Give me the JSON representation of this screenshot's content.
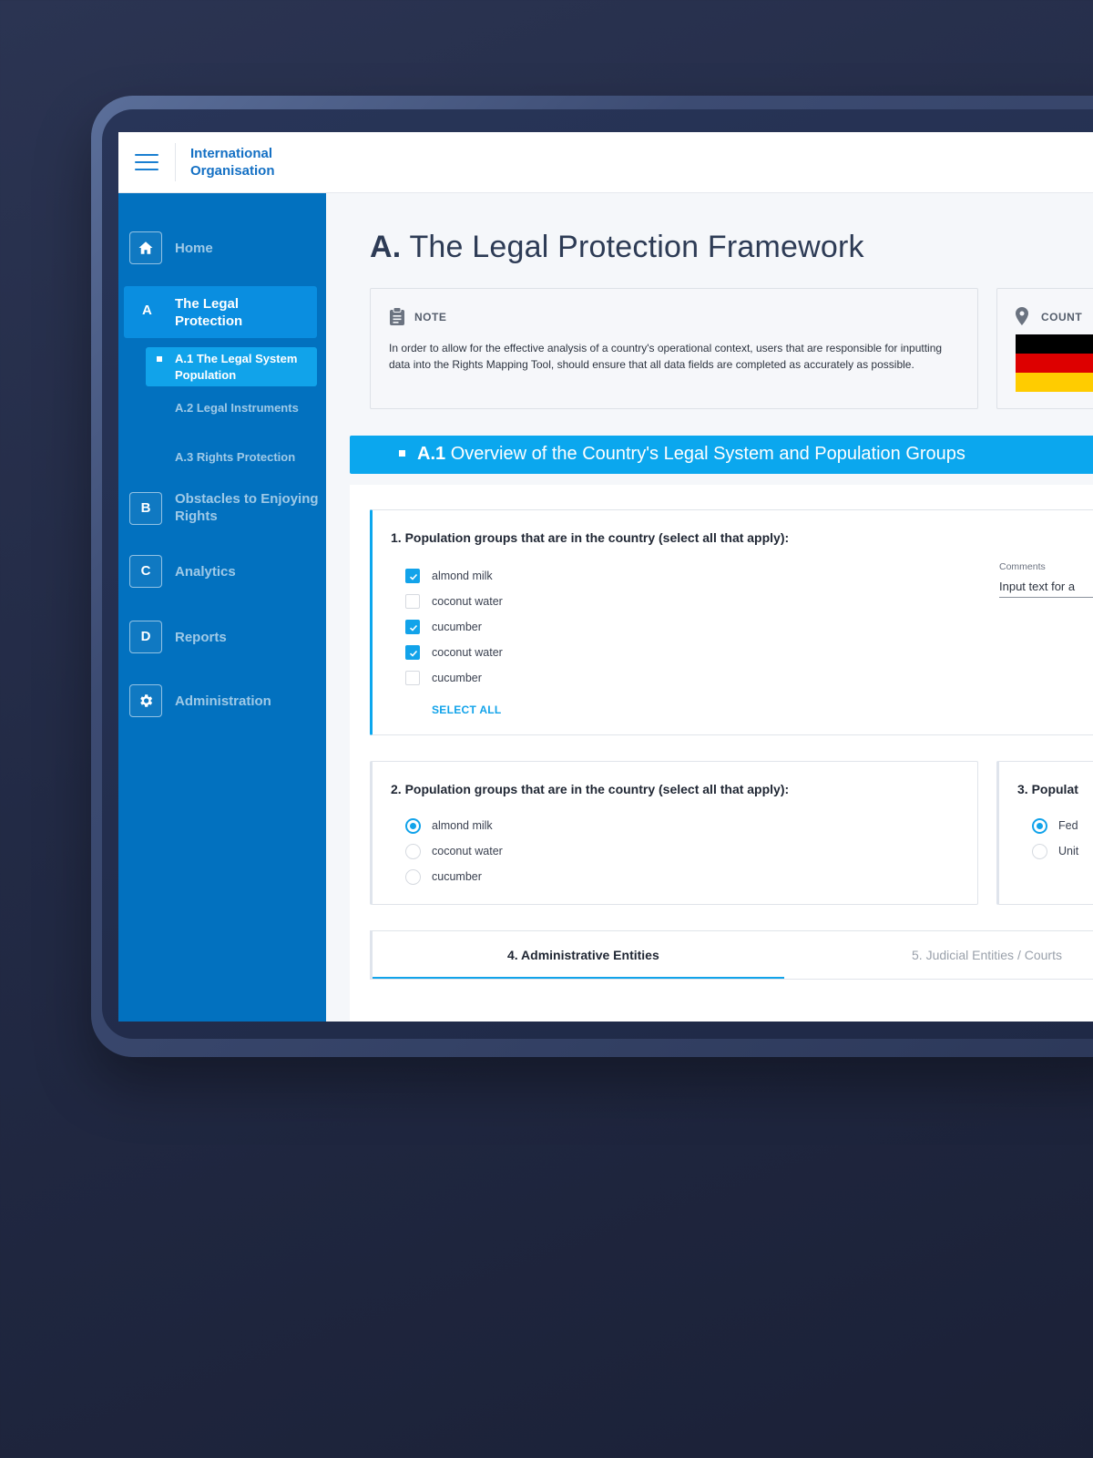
{
  "app": {
    "brand": "International Organisation"
  },
  "sidebar": {
    "home": {
      "label": "Home",
      "icon": "home-icon"
    },
    "active_section": {
      "letter": "A",
      "label": "The Legal Protection"
    },
    "sub_items": [
      {
        "label": "A.1 The Legal System Population",
        "active": true
      },
      {
        "label": "A.2 Legal Instruments",
        "active": false
      },
      {
        "label": "A.3 Rights Protection",
        "active": false
      }
    ],
    "sections": [
      {
        "letter": "B",
        "label": "Obstacles to Enjoying Rights"
      },
      {
        "letter": "C",
        "label": "Analytics"
      },
      {
        "letter": "D",
        "label": "Reports"
      }
    ],
    "admin": {
      "label": "Administration",
      "icon": "gear-icon"
    }
  },
  "page": {
    "title_prefix": "A.",
    "title": "The Legal Protection Framework"
  },
  "note": {
    "heading": "NOTE",
    "text": "In order to allow for the effective analysis of a country's operational context, users that are responsible for inputting data into the Rights Mapping Tool, should ensure that all data fields are completed as accurately as possible."
  },
  "country": {
    "heading": "COUNT",
    "flag_colors": [
      "#000000",
      "#dd0000",
      "#ffcc00"
    ]
  },
  "section": {
    "number": "A.1",
    "title": "Overview of the Country's Legal System and Population Groups"
  },
  "question1": {
    "title": "1.  Population groups that are in the country (select all that apply):",
    "options": [
      {
        "label": "almond milk",
        "checked": true
      },
      {
        "label": "coconut water",
        "checked": false
      },
      {
        "label": "cucumber",
        "checked": true
      },
      {
        "label": "coconut water",
        "checked": true
      },
      {
        "label": "cucumber",
        "checked": false
      }
    ],
    "select_all": "SELECT ALL",
    "comments_label": "Comments",
    "comments_placeholder": "Input text for a"
  },
  "question2": {
    "title": "2. Population groups that are in the country (select all that apply):",
    "options": [
      {
        "label": "almond milk",
        "selected": true
      },
      {
        "label": "coconut water",
        "selected": false
      },
      {
        "label": "cucumber",
        "selected": false
      }
    ]
  },
  "question3": {
    "title": "3.  Populat",
    "options": [
      {
        "label": "Fed",
        "selected": true
      },
      {
        "label": "Unit",
        "selected": false
      }
    ]
  },
  "tabs": [
    {
      "label": "4. Administrative Entities",
      "active": true
    },
    {
      "label": "5. Judicial Entities / Courts",
      "active": false
    }
  ],
  "colors": {
    "sidebar": "#0271bf",
    "accent": "#0ba7ee",
    "brand_text": "#1470c4"
  }
}
